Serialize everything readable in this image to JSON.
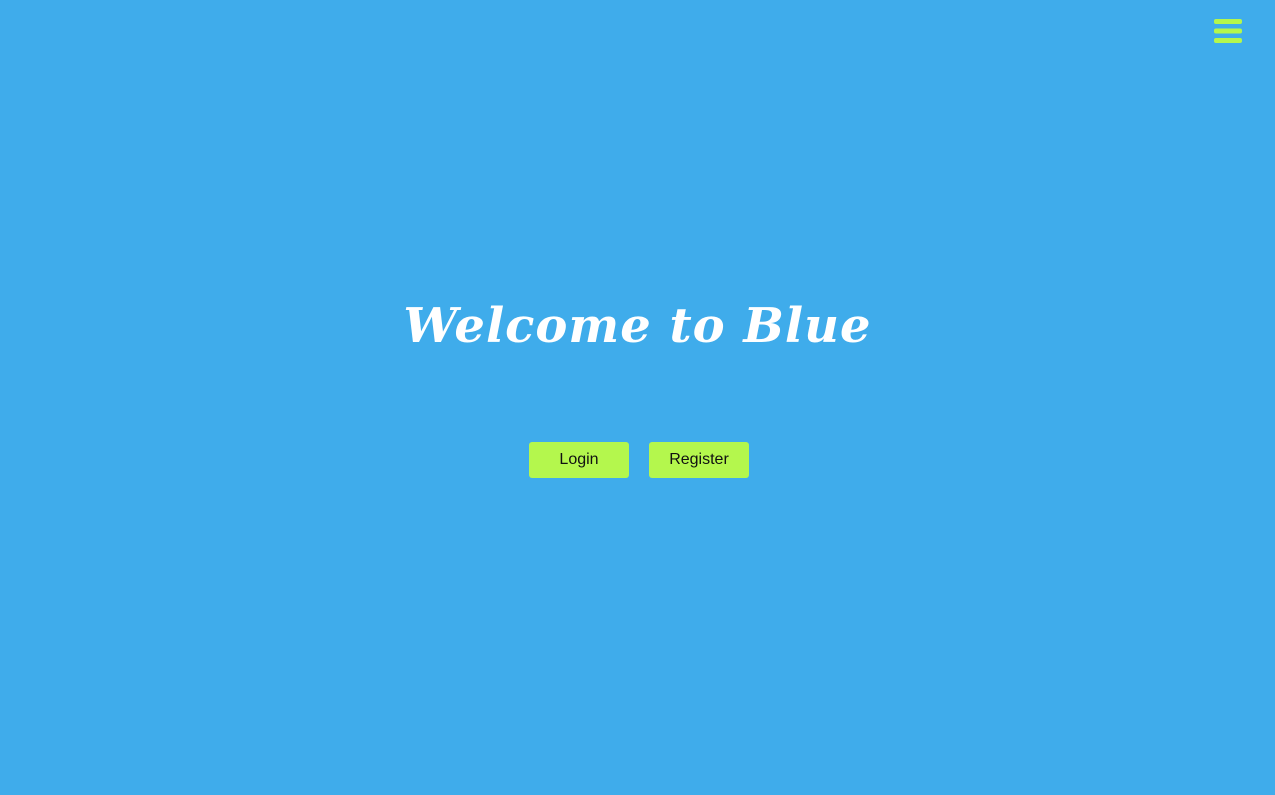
{
  "header": {
    "menu_icon": "hamburger-menu-icon"
  },
  "hero": {
    "title": "Welcome to Blue"
  },
  "actions": {
    "login_label": "Login",
    "register_label": "Register"
  },
  "colors": {
    "background": "#3faceb",
    "accent": "#b4f74d",
    "title_text": "#ffffff",
    "button_text": "#111111"
  }
}
